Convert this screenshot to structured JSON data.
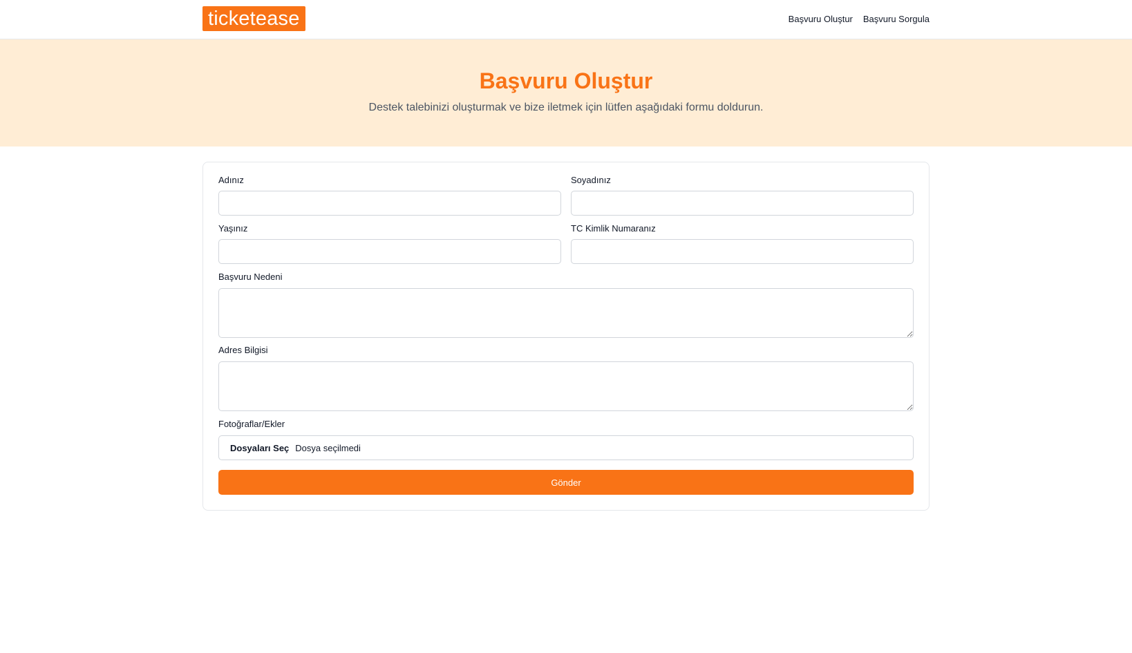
{
  "brand": {
    "logo_text": "ticketease",
    "accent": "#f97316",
    "hero_bg": "#ffedd5"
  },
  "nav": {
    "items": [
      {
        "label": "Başvuru Oluştur"
      },
      {
        "label": "Başvuru Sorgula"
      }
    ]
  },
  "hero": {
    "title": "Başvuru Oluştur",
    "subtitle": "Destek talebinizi oluşturmak ve bize iletmek için lütfen aşağıdaki formu doldurun."
  },
  "form": {
    "first_name": {
      "label": "Adınız",
      "value": ""
    },
    "last_name": {
      "label": "Soyadınız",
      "value": ""
    },
    "age": {
      "label": "Yaşınız",
      "value": ""
    },
    "tc_number": {
      "label": "TC Kimlik Numaranız",
      "value": ""
    },
    "reason": {
      "label": "Başvuru Nedeni",
      "value": ""
    },
    "address": {
      "label": "Adres Bilgisi",
      "value": ""
    },
    "attachments": {
      "label": "Fotoğraflar/Ekler",
      "button_label": "Dosyaları Seç",
      "status": "Dosya seçilmedi"
    },
    "submit_label": "Gönder"
  }
}
